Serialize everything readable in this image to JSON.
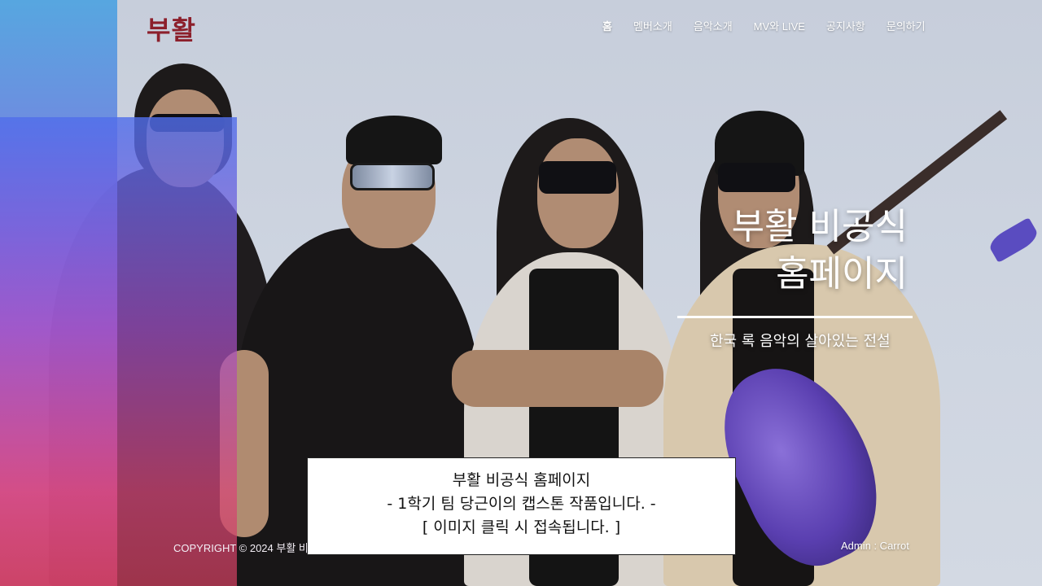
{
  "header": {
    "logo": "부활",
    "nav": [
      {
        "label": "홈",
        "active": true
      },
      {
        "label": "멤버소개",
        "active": false
      },
      {
        "label": "음악소개",
        "active": false
      },
      {
        "label": "MV와 LIVE",
        "active": false
      },
      {
        "label": "공지사항",
        "active": false
      },
      {
        "label": "문의하기",
        "active": false
      }
    ]
  },
  "hero": {
    "title_line1": "부활 비공식",
    "title_line2": "홈페이지",
    "subtitle": "한국 록 음악의 살아있는 전설"
  },
  "footer": {
    "copyright": "COPYRIGHT © 2024 부활 비",
    "admin": "Admin : Carrot"
  },
  "popup": {
    "line1": "부활 비공식 홈페이지",
    "line2": "-   1학기 팀 당근이의 캡스톤 작품입니다. -",
    "line3": "[ 이미지 클릭 시 접속됩니다. ]"
  },
  "colors": {
    "logo": "#8c1f2b",
    "panel_top": "#4da3e0",
    "panel_bottom": "#d94f8a",
    "hero_text": "#ffffff"
  }
}
